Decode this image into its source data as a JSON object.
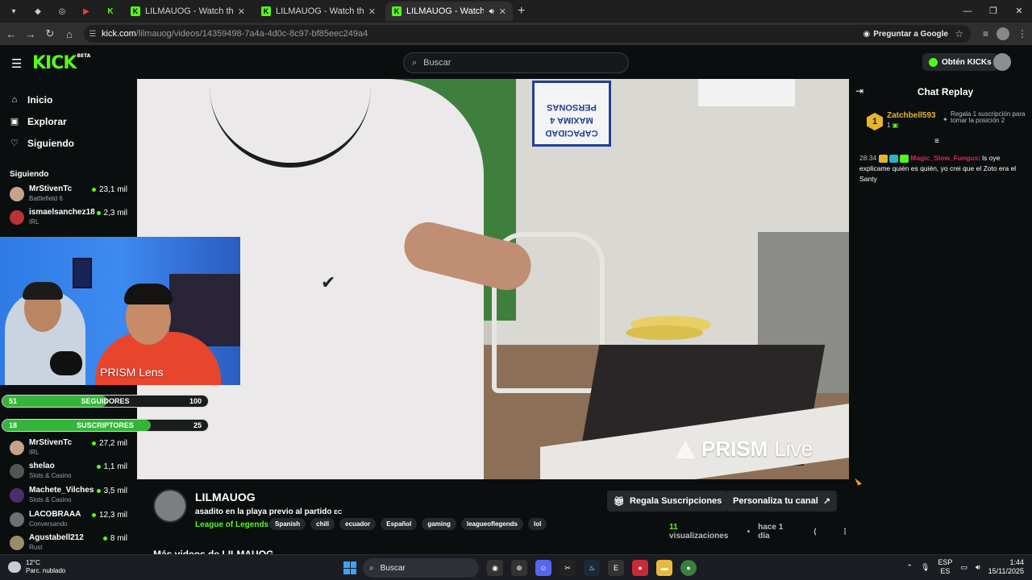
{
  "browser": {
    "tabs": [
      {
        "title": "LILMAUOG - Watch the VOD on",
        "active": false
      },
      {
        "title": "LILMAUOG - Watch the VOD on",
        "active": false
      },
      {
        "title": "LILMAUOG - Watch the VOD",
        "active": true
      }
    ],
    "close_glyph": "✕",
    "new_tab_glyph": "+",
    "url_host": "kick.com",
    "url_path": "/lilmauog/videos/14359498-7a4a-4d0c-8c97-bf85eec249a4",
    "ask_google": "Preguntar a Google"
  },
  "header": {
    "logo": "KICK",
    "logo_badge": "BETA",
    "search_placeholder": "Buscar",
    "get_kicks": "Obtén KICKs"
  },
  "sidebar": {
    "nav": [
      {
        "label": "Inicio",
        "icon": "home-icon"
      },
      {
        "label": "Explorar",
        "icon": "compass-icon"
      },
      {
        "label": "Siguiendo",
        "icon": "heart-icon"
      }
    ],
    "following_title": "Siguiendo",
    "channels": [
      {
        "name": "MrStivenTc",
        "category": "Battlefield 6",
        "viewers": "23,1 mil"
      },
      {
        "name": "ismaelsanchez18",
        "category": "IRL",
        "viewers": "2,3 mil"
      },
      {
        "name": "MrStivenTc",
        "category": "IRL",
        "viewers": "27,2 mil"
      },
      {
        "name": "shelao",
        "category": "Slots & Casino",
        "viewers": "1,1 mil"
      },
      {
        "name": "Machete_Vilches",
        "category": "Slots & Casino",
        "viewers": "3,5 mil"
      },
      {
        "name": "LACOBRAAA",
        "category": "Conversando",
        "viewers": "12,3 mil"
      },
      {
        "name": "Agustabell212",
        "category": "Rust",
        "viewers": "8 mil"
      }
    ]
  },
  "overlay": {
    "lens_label": "PRISM Lens",
    "goals": [
      {
        "current": "51",
        "label": "SEGUIDORES",
        "target": "100",
        "fraction": 0.51
      },
      {
        "current": "18",
        "label": "SUSCRIPTORES",
        "target": "25",
        "fraction": 0.72
      }
    ]
  },
  "video": {
    "sign_text": "CAPACIDAD MAXIMA 4 PERSONAS",
    "watermark_bold": "PRISM",
    "watermark_light": "Live"
  },
  "stream": {
    "channel": "LILMAUOG",
    "title": "asadito en la playa previo al partido",
    "title_badge": "EC",
    "category": "League of Legends",
    "tags": [
      "Spanish",
      "chill",
      "ecuador",
      "Español",
      "gaming",
      "leagueoflegends",
      "lol"
    ],
    "gift_button": "Regala Suscripciones",
    "customize_button": "Personaliza tu canal",
    "views_count": "11",
    "views_label": "visualizaciones",
    "ago": "hace 1 día",
    "more_videos": "Más videos de LILMAUOG"
  },
  "chat": {
    "title": "Chat Replay",
    "pinned": {
      "rank": "1",
      "user": "Zatchbell593",
      "subs": "1",
      "gift_text": "Regala 1 suscripción para tomar la posición 2"
    },
    "messages": [
      {
        "time": "28:34",
        "user": "Magic_Slow_Fungus",
        "text": "ls oye explicame quién es quién, yo crei que el Zoto era el Santy"
      }
    ]
  },
  "taskbar": {
    "temp": "12°C",
    "weather": "Parc. nublado",
    "search": "Buscar",
    "lang_top": "ESP",
    "lang_bottom": "ES",
    "time": "1:44",
    "date": "15/11/2025"
  },
  "colors": {
    "accent": "#53fc18",
    "chat_user": "#e2215f",
    "pinned_user": "#e6b52f"
  }
}
